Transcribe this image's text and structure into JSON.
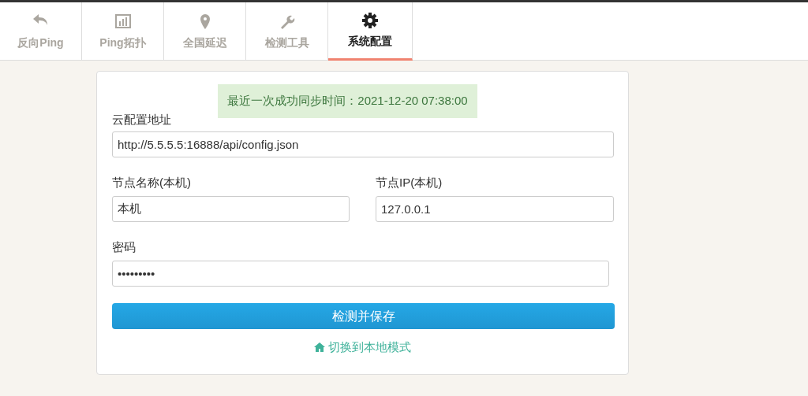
{
  "tabs": [
    {
      "label": "反向Ping",
      "kind": "reply",
      "selected": false
    },
    {
      "label": "Ping拓扑",
      "kind": "chart",
      "selected": false
    },
    {
      "label": "全国延迟",
      "kind": "pin",
      "selected": false
    },
    {
      "label": "检测工具",
      "kind": "wrench",
      "selected": false
    },
    {
      "label": "系统配置",
      "kind": "gear",
      "selected": true
    }
  ],
  "sync_notice": "最近一次成功同步时间：2021-12-20 07:38:00",
  "form": {
    "cloud_url": {
      "label": "云配置地址",
      "value": "http://5.5.5.5:16888/api/config.json"
    },
    "node_name": {
      "label": "节点名称(本机)",
      "value": "本机"
    },
    "node_ip": {
      "label": "节点IP(本机)",
      "value": "127.0.0.1"
    },
    "password": {
      "label": "密码",
      "value": "•••••••••"
    }
  },
  "save_button": "检测并保存",
  "local_mode_link": "切换到本地模式"
}
